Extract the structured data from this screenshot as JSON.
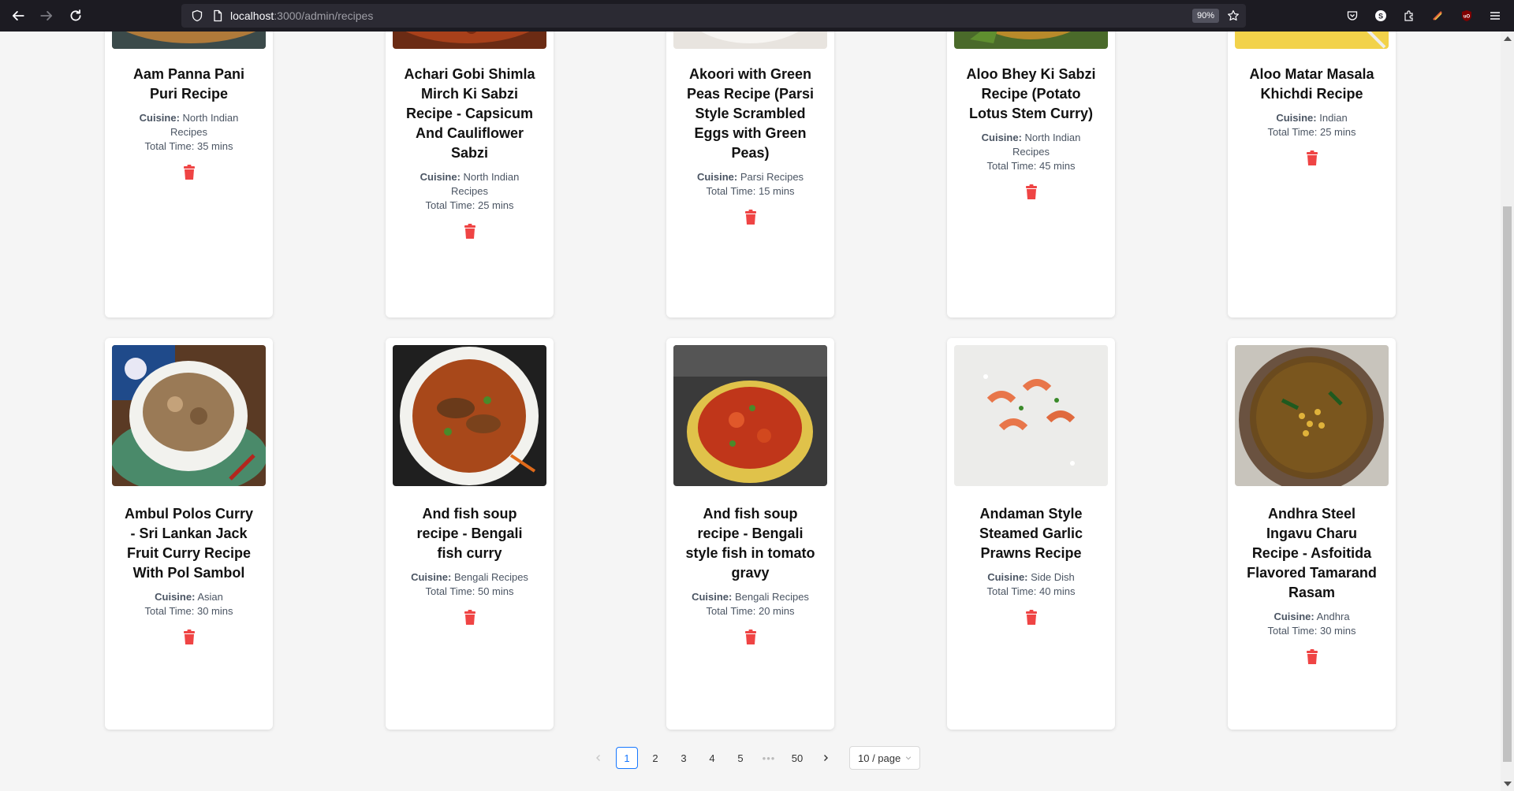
{
  "browser": {
    "url_host": "localhost",
    "url_path": ":3000/admin/recipes",
    "zoom": "90%"
  },
  "cuisine_label": "Cuisine:",
  "time_label": "Total Time:",
  "recipes_row1": [
    {
      "title": "Aam Panna Pani Puri Recipe",
      "cuisine": "North Indian Recipes",
      "time": "35 mins"
    },
    {
      "title": "Achari Gobi Shimla Mirch Ki Sabzi Recipe - Capsicum And Cauliflower Sabzi",
      "cuisine": "North Indian Recipes",
      "time": "25 mins"
    },
    {
      "title": "Akoori with Green Peas Recipe (Parsi Style Scrambled Eggs with Green Peas)",
      "cuisine": "Parsi Recipes",
      "time": "15 mins"
    },
    {
      "title": "Aloo Bhey Ki Sabzi Recipe (Potato Lotus Stem Curry)",
      "cuisine": "North Indian Recipes",
      "time": "45 mins"
    },
    {
      "title": "Aloo Matar Masala Khichdi Recipe",
      "cuisine": "Indian",
      "time": "25 mins"
    }
  ],
  "recipes_row2": [
    {
      "title": "Ambul Polos Curry - Sri Lankan Jack Fruit Curry Recipe With Pol Sambol",
      "cuisine": "Asian",
      "time": "30 mins"
    },
    {
      "title": "And fish soup recipe - Bengali fish curry",
      "cuisine": "Bengali Recipes",
      "time": "50 mins"
    },
    {
      "title": "And fish soup recipe - Bengali style fish in tomato gravy",
      "cuisine": "Bengali Recipes",
      "time": "20 mins"
    },
    {
      "title": "Andaman Style Steamed Garlic Prawns Recipe",
      "cuisine": "Side Dish",
      "time": "40 mins"
    },
    {
      "title": "Andhra Steel Ingavu Charu Recipe - Asfoitida Flavored Tamarand Rasam",
      "cuisine": "Andhra",
      "time": "30 mins"
    }
  ],
  "pagination": {
    "pages": [
      "1",
      "2",
      "3",
      "4",
      "5"
    ],
    "ellipsis": "•••",
    "last": "50",
    "active": "1",
    "page_size": "10 / page"
  },
  "colors": {
    "delete": "#ef4444",
    "active_page": "#1677ff"
  }
}
